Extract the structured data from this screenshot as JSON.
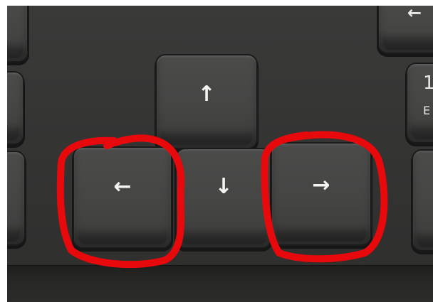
{
  "keys": {
    "up": {
      "symbol": "↑"
    },
    "down": {
      "symbol": "↓"
    },
    "left": {
      "symbol": "←"
    },
    "right": {
      "symbol": "→"
    },
    "edge_top_right": {
      "symbol": "←"
    },
    "edge_numpad": {
      "number": "1",
      "sub": "E"
    }
  },
  "annotation": {
    "color": "#e8090c",
    "circled_keys": [
      "left",
      "right"
    ]
  }
}
